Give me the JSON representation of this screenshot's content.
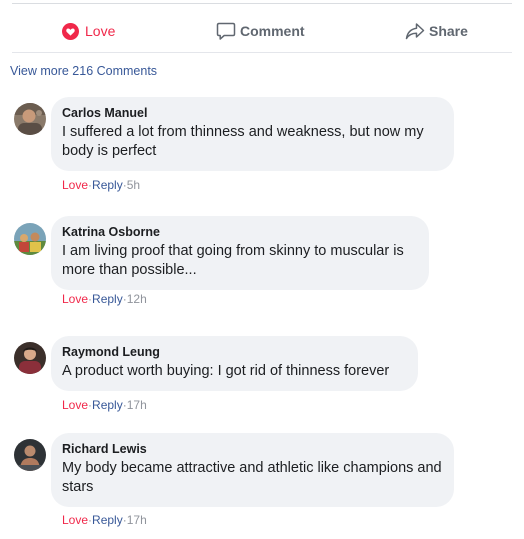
{
  "actions": {
    "love_label": "Love",
    "comment_label": "Comment",
    "share_label": "Share",
    "love_color": "#f0284a"
  },
  "view_more": "View more 216 Comments",
  "comments": [
    {
      "author": "Carlos Manuel",
      "text": "I suffered a lot from thinness and weakness, but now my body is perfect",
      "love": "Love",
      "reply": "Reply",
      "sep": "·",
      "time": "5h"
    },
    {
      "author": "Katrina Osborne",
      "text": "I am living proof that going from skinny to muscular is more than possible...",
      "love": "Love",
      "reply": "Reply",
      "sep": "·",
      "time": "12h"
    },
    {
      "author": "Raymond Leung",
      "text": "A product worth buying: I got rid of thinness forever",
      "love": "Love",
      "reply": "Reply",
      "sep": "·",
      "time": "17h"
    },
    {
      "author": "Richard Lewis",
      "text": "My body became attractive and athletic like champions and stars",
      "love": "Love",
      "reply": "Reply",
      "sep": "·",
      "time": "17h"
    }
  ]
}
